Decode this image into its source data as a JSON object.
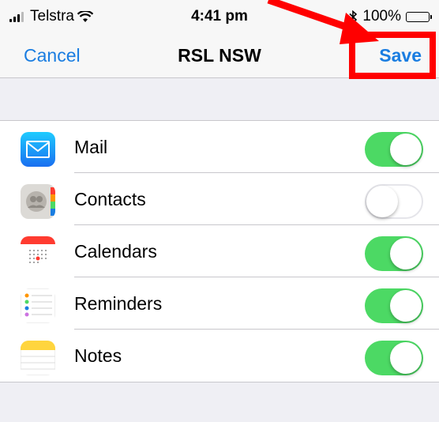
{
  "status_bar": {
    "carrier": "Telstra",
    "time": "4:41 pm",
    "battery": "100%"
  },
  "navbar": {
    "cancel": "Cancel",
    "title": "RSL NSW",
    "save": "Save"
  },
  "items": [
    {
      "label": "Mail",
      "icon": "mail-icon",
      "enabled": true
    },
    {
      "label": "Contacts",
      "icon": "contacts-icon",
      "enabled": false
    },
    {
      "label": "Calendars",
      "icon": "calendar-icon",
      "enabled": true
    },
    {
      "label": "Reminders",
      "icon": "reminders-icon",
      "enabled": true
    },
    {
      "label": "Notes",
      "icon": "notes-icon",
      "enabled": true
    }
  ],
  "colors": {
    "accent": "#1a7de1",
    "toggle_on": "#4cd964",
    "highlight": "#ff0000"
  }
}
